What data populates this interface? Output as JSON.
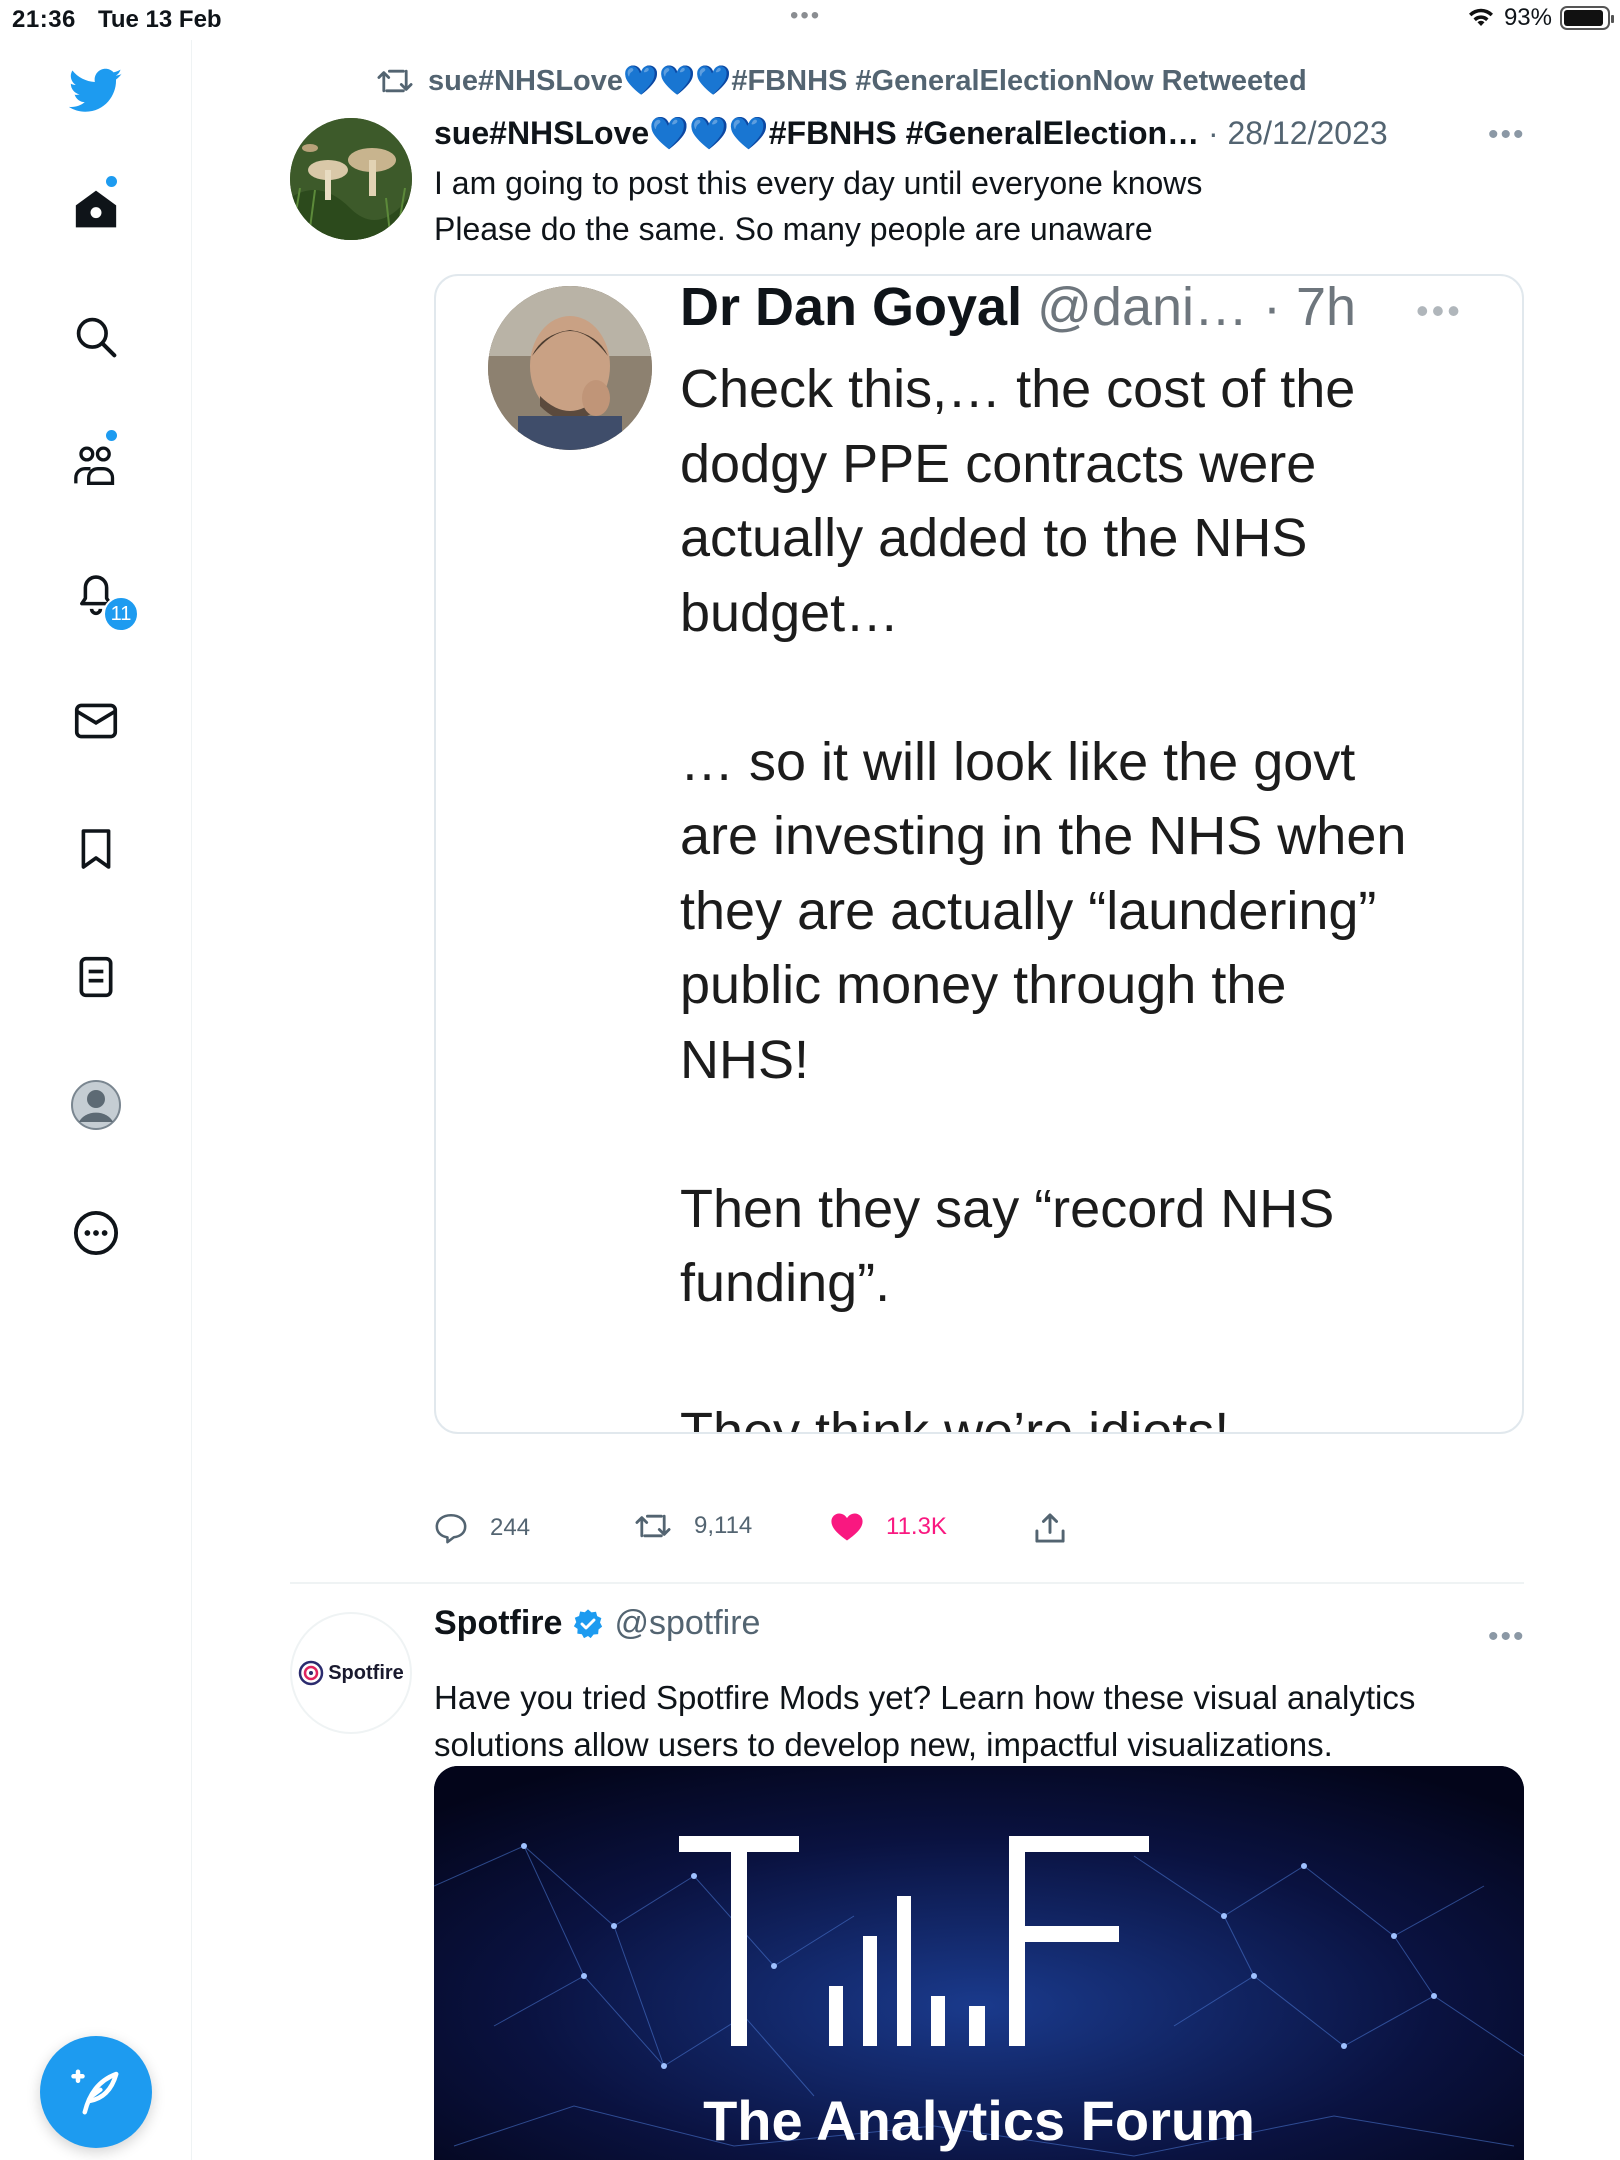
{
  "status_bar": {
    "time": "21:36",
    "date": "Tue 13 Feb",
    "battery": "93%",
    "battery_level": 0.93
  },
  "sidebar": {
    "brand_icon": "twitter-bird-icon",
    "items": [
      {
        "icon": "home-icon",
        "has_dot": true
      },
      {
        "icon": "search-icon",
        "has_dot": false
      },
      {
        "icon": "communities-icon",
        "has_dot": true
      },
      {
        "icon": "bell-icon",
        "badge": "11"
      },
      {
        "icon": "mail-icon"
      },
      {
        "icon": "bookmark-icon"
      },
      {
        "icon": "lists-icon"
      },
      {
        "icon": "profile-avatar-icon"
      },
      {
        "icon": "more-circle-icon"
      }
    ],
    "compose_icon": "compose-feather-icon"
  },
  "tweet1": {
    "retweet_line": "sue#NHSLove💙💙💙#FBNHS #GeneralElectionNow Retweeted",
    "author": "sue#NHSLove💙💙💙#FBNHS #GeneralElection…",
    "meta": " · 28/12/2023",
    "text_line1": "I am going to post this every day until everyone knows",
    "text_line2": "Please do the same. So many people are unaware",
    "quote": {
      "name": "Dr Dan Goyal",
      "meta": " @dani… · 7h",
      "para1": "Check this,… the cost of the\ndodgy PPE contracts were\nactually added to the NHS\nbudget…",
      "para2": "… so it will look like the govt\nare investing in the NHS when\nthey are actually “laundering”\npublic money through the\nNHS!",
      "para3": "Then they say “record NHS\nfunding”.",
      "para4": "They think we’re idiots!"
    },
    "replies": "244",
    "retweets": "9,114",
    "likes": "11.3K"
  },
  "tweet2": {
    "author": "Spotfire",
    "handle": "@spotfire",
    "avatar_text": "Spotfire",
    "text_line1": "Have you tried Spotfire Mods yet? Learn how these visual analytics",
    "text_line2": "solutions allow users to develop new, impactful visualizations.",
    "image_caption": "The Analytics Forum"
  },
  "colors": {
    "accent": "#1d9bf0",
    "like": "#f91880",
    "secondary_text": "#536471"
  }
}
